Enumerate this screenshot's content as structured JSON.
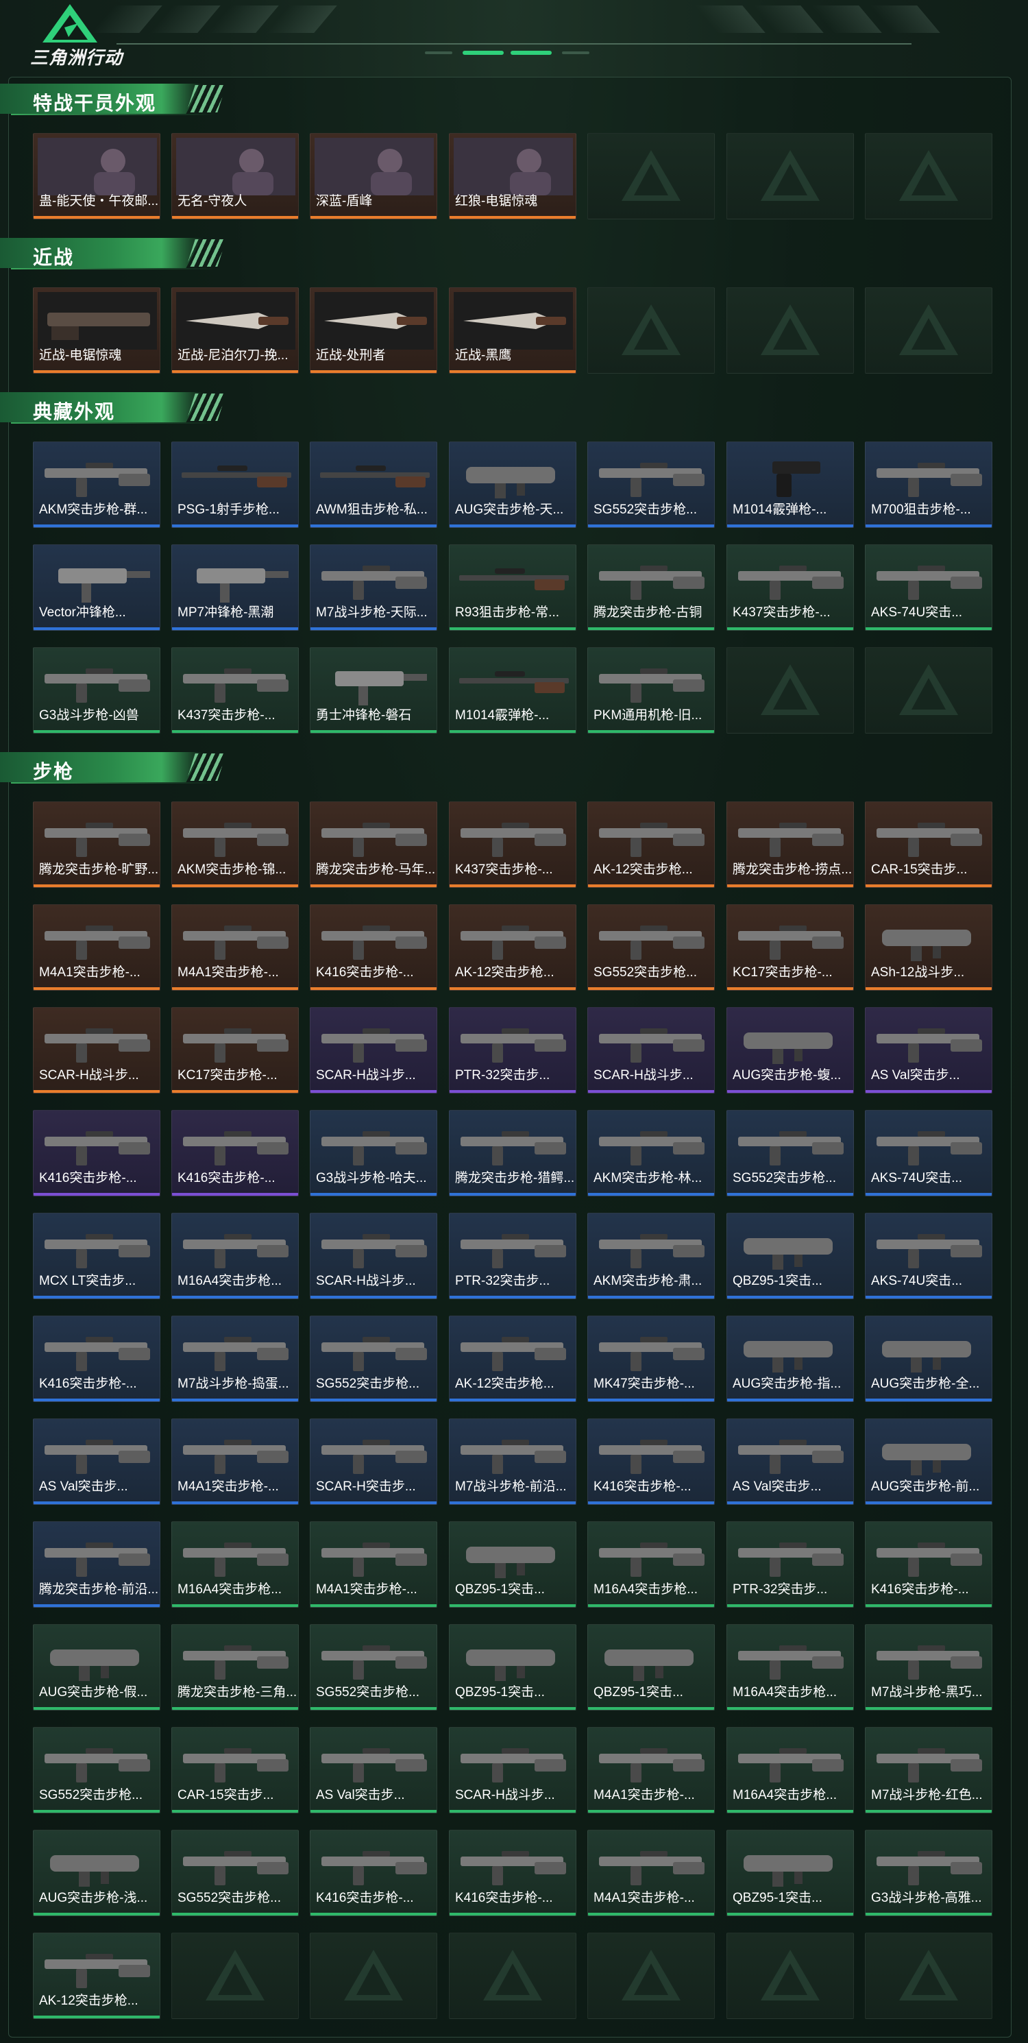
{
  "app": {
    "brand": "三角洲行动"
  },
  "colors": {
    "orange": "#e97d2c",
    "purple": "#7b4fd4",
    "blue": "#2f72d8",
    "green": "#2fb86a",
    "accent": "#3aa85c"
  },
  "sections": [
    {
      "title": "特战干员外观",
      "rows": 1,
      "items": [
        {
          "name": "蛊-能天使・午夜邮...",
          "rarity": "orange",
          "icon": "operator-portrait"
        },
        {
          "name": "无名-守夜人",
          "rarity": "orange",
          "icon": "operator-portrait"
        },
        {
          "name": "深蓝-盾峰",
          "rarity": "orange",
          "icon": "operator-portrait"
        },
        {
          "name": "红狼-电锯惊魂",
          "rarity": "orange",
          "icon": "operator-portrait"
        }
      ]
    },
    {
      "title": "近战",
      "rows": 1,
      "items": [
        {
          "name": "近战-电锯惊魂",
          "rarity": "orange",
          "icon": "chainsaw"
        },
        {
          "name": "近战-尼泊尔刀-挽...",
          "rarity": "orange",
          "icon": "knife"
        },
        {
          "name": "近战-处刑者",
          "rarity": "orange",
          "icon": "knife"
        },
        {
          "name": "近战-黑鹰",
          "rarity": "orange",
          "icon": "knife"
        }
      ]
    },
    {
      "title": "典藏外观",
      "rows": 3,
      "items": [
        {
          "name": "AKM突击步枪-群...",
          "rarity": "blue",
          "icon": "rifle"
        },
        {
          "name": "PSG-1射手步枪...",
          "rarity": "blue",
          "icon": "sniper"
        },
        {
          "name": "AWM狙击步枪-私...",
          "rarity": "blue",
          "icon": "sniper"
        },
        {
          "name": "AUG突击步枪-天...",
          "rarity": "blue",
          "icon": "bullpup"
        },
        {
          "name": "SG552突击步枪...",
          "rarity": "blue",
          "icon": "rifle"
        },
        {
          "name": "M1014霰弹枪-...",
          "rarity": "blue",
          "icon": "pistol"
        },
        {
          "name": "M700狙击步枪-...",
          "rarity": "blue",
          "icon": "rifle"
        },
        {
          "name": "Vector冲锋枪...",
          "rarity": "blue",
          "icon": "smg"
        },
        {
          "name": "MP7冲锋枪-黑潮",
          "rarity": "blue",
          "icon": "smg"
        },
        {
          "name": "M7战斗步枪-天际...",
          "rarity": "blue",
          "icon": "rifle"
        },
        {
          "name": "R93狙击步枪-常...",
          "rarity": "green",
          "icon": "sniper"
        },
        {
          "name": "腾龙突击步枪-古铜",
          "rarity": "green",
          "icon": "rifle"
        },
        {
          "name": "K437突击步枪-...",
          "rarity": "green",
          "icon": "rifle"
        },
        {
          "name": "AKS-74U突击...",
          "rarity": "green",
          "icon": "rifle"
        },
        {
          "name": "G3战斗步枪-凶兽",
          "rarity": "green",
          "icon": "rifle"
        },
        {
          "name": "K437突击步枪-...",
          "rarity": "green",
          "icon": "rifle"
        },
        {
          "name": "勇士冲锋枪-磐石",
          "rarity": "green",
          "icon": "smg"
        },
        {
          "name": "M1014霰弹枪-...",
          "rarity": "green",
          "icon": "sniper"
        },
        {
          "name": "PKM通用机枪-旧...",
          "rarity": "green",
          "icon": "rifle"
        }
      ]
    },
    {
      "title": "步枪",
      "rows": 12,
      "items": [
        {
          "name": "腾龙突击步枪-旷野...",
          "rarity": "orange",
          "icon": "rifle"
        },
        {
          "name": "AKM突击步枪-锦...",
          "rarity": "orange",
          "icon": "rifle"
        },
        {
          "name": "腾龙突击步枪-马年...",
          "rarity": "orange",
          "icon": "rifle"
        },
        {
          "name": "K437突击步枪-...",
          "rarity": "orange",
          "icon": "rifle"
        },
        {
          "name": "AK-12突击步枪...",
          "rarity": "orange",
          "icon": "rifle"
        },
        {
          "name": "腾龙突击步枪-捞点...",
          "rarity": "orange",
          "icon": "rifle"
        },
        {
          "name": "CAR-15突击步...",
          "rarity": "orange",
          "icon": "rifle"
        },
        {
          "name": "M4A1突击步枪-...",
          "rarity": "orange",
          "icon": "rifle"
        },
        {
          "name": "M4A1突击步枪-...",
          "rarity": "orange",
          "icon": "rifle"
        },
        {
          "name": "K416突击步枪-...",
          "rarity": "orange",
          "icon": "rifle"
        },
        {
          "name": "AK-12突击步枪...",
          "rarity": "orange",
          "icon": "rifle"
        },
        {
          "name": "SG552突击步枪...",
          "rarity": "orange",
          "icon": "rifle"
        },
        {
          "name": "KC17突击步枪-...",
          "rarity": "orange",
          "icon": "rifle"
        },
        {
          "name": "ASh-12战斗步...",
          "rarity": "orange",
          "icon": "bullpup"
        },
        {
          "name": "SCAR-H战斗步...",
          "rarity": "orange",
          "icon": "rifle"
        },
        {
          "name": "KC17突击步枪-...",
          "rarity": "orange",
          "icon": "rifle"
        },
        {
          "name": "SCAR-H战斗步...",
          "rarity": "purple",
          "icon": "rifle"
        },
        {
          "name": "PTR-32突击步...",
          "rarity": "purple",
          "icon": "rifle"
        },
        {
          "name": "SCAR-H战斗步...",
          "rarity": "purple",
          "icon": "rifle"
        },
        {
          "name": "AUG突击步枪-蝮...",
          "rarity": "purple",
          "icon": "bullpup"
        },
        {
          "name": "AS Val突击步...",
          "rarity": "purple",
          "icon": "rifle"
        },
        {
          "name": "K416突击步枪-...",
          "rarity": "purple",
          "icon": "rifle"
        },
        {
          "name": "K416突击步枪-...",
          "rarity": "purple",
          "icon": "rifle"
        },
        {
          "name": "G3战斗步枪-哈夫...",
          "rarity": "blue",
          "icon": "rifle"
        },
        {
          "name": "腾龙突击步枪-猎鳄...",
          "rarity": "blue",
          "icon": "rifle"
        },
        {
          "name": "AKM突击步枪-林...",
          "rarity": "blue",
          "icon": "rifle"
        },
        {
          "name": "SG552突击步枪...",
          "rarity": "blue",
          "icon": "rifle"
        },
        {
          "name": "AKS-74U突击...",
          "rarity": "blue",
          "icon": "rifle"
        },
        {
          "name": "MCX LT突击步...",
          "rarity": "blue",
          "icon": "rifle"
        },
        {
          "name": "M16A4突击步枪...",
          "rarity": "blue",
          "icon": "rifle"
        },
        {
          "name": "SCAR-H战斗步...",
          "rarity": "blue",
          "icon": "rifle"
        },
        {
          "name": "PTR-32突击步...",
          "rarity": "blue",
          "icon": "rifle"
        },
        {
          "name": "AKM突击步枪-肃...",
          "rarity": "blue",
          "icon": "rifle"
        },
        {
          "name": "QBZ95-1突击...",
          "rarity": "blue",
          "icon": "bullpup"
        },
        {
          "name": "AKS-74U突击...",
          "rarity": "blue",
          "icon": "rifle"
        },
        {
          "name": "K416突击步枪-...",
          "rarity": "blue",
          "icon": "rifle"
        },
        {
          "name": "M7战斗步枪-捣蛋...",
          "rarity": "blue",
          "icon": "rifle"
        },
        {
          "name": "SG552突击步枪...",
          "rarity": "blue",
          "icon": "rifle"
        },
        {
          "name": "AK-12突击步枪...",
          "rarity": "blue",
          "icon": "rifle"
        },
        {
          "name": "MK47突击步枪-...",
          "rarity": "blue",
          "icon": "rifle"
        },
        {
          "name": "AUG突击步枪-指...",
          "rarity": "blue",
          "icon": "bullpup"
        },
        {
          "name": "AUG突击步枪-全...",
          "rarity": "blue",
          "icon": "bullpup"
        },
        {
          "name": "AS Val突击步...",
          "rarity": "blue",
          "icon": "rifle"
        },
        {
          "name": "M4A1突击步枪-...",
          "rarity": "blue",
          "icon": "rifle"
        },
        {
          "name": "SCAR-H突击步...",
          "rarity": "blue",
          "icon": "rifle"
        },
        {
          "name": "M7战斗步枪-前沿...",
          "rarity": "blue",
          "icon": "rifle"
        },
        {
          "name": "K416突击步枪-...",
          "rarity": "blue",
          "icon": "rifle"
        },
        {
          "name": "AS Val突击步...",
          "rarity": "blue",
          "icon": "rifle"
        },
        {
          "name": "AUG突击步枪-前...",
          "rarity": "blue",
          "icon": "bullpup"
        },
        {
          "name": "腾龙突击步枪-前沿...",
          "rarity": "blue",
          "icon": "rifle"
        },
        {
          "name": "M16A4突击步枪...",
          "rarity": "green",
          "icon": "rifle"
        },
        {
          "name": "M4A1突击步枪-...",
          "rarity": "green",
          "icon": "rifle"
        },
        {
          "name": "QBZ95-1突击...",
          "rarity": "green",
          "icon": "bullpup"
        },
        {
          "name": "M16A4突击步枪...",
          "rarity": "green",
          "icon": "rifle"
        },
        {
          "name": "PTR-32突击步...",
          "rarity": "green",
          "icon": "rifle"
        },
        {
          "name": "K416突击步枪-...",
          "rarity": "green",
          "icon": "rifle"
        },
        {
          "name": "AUG突击步枪-假...",
          "rarity": "green",
          "icon": "bullpup"
        },
        {
          "name": "腾龙突击步枪-三角...",
          "rarity": "green",
          "icon": "rifle"
        },
        {
          "name": "SG552突击步枪...",
          "rarity": "green",
          "icon": "rifle"
        },
        {
          "name": "QBZ95-1突击...",
          "rarity": "green",
          "icon": "bullpup"
        },
        {
          "name": "QBZ95-1突击...",
          "rarity": "green",
          "icon": "bullpup"
        },
        {
          "name": "M16A4突击步枪...",
          "rarity": "green",
          "icon": "rifle"
        },
        {
          "name": "M7战斗步枪-黑巧...",
          "rarity": "green",
          "icon": "rifle"
        },
        {
          "name": "SG552突击步枪...",
          "rarity": "green",
          "icon": "rifle"
        },
        {
          "name": "CAR-15突击步...",
          "rarity": "green",
          "icon": "rifle"
        },
        {
          "name": "AS Val突击步...",
          "rarity": "green",
          "icon": "rifle"
        },
        {
          "name": "SCAR-H战斗步...",
          "rarity": "green",
          "icon": "rifle"
        },
        {
          "name": "M4A1突击步枪-...",
          "rarity": "green",
          "icon": "rifle"
        },
        {
          "name": "M16A4突击步枪...",
          "rarity": "green",
          "icon": "rifle"
        },
        {
          "name": "M7战斗步枪-红色...",
          "rarity": "green",
          "icon": "rifle"
        },
        {
          "name": "AUG突击步枪-浅...",
          "rarity": "green",
          "icon": "bullpup"
        },
        {
          "name": "SG552突击步枪...",
          "rarity": "green",
          "icon": "rifle"
        },
        {
          "name": "K416突击步枪-...",
          "rarity": "green",
          "icon": "rifle"
        },
        {
          "name": "K416突击步枪-...",
          "rarity": "green",
          "icon": "rifle"
        },
        {
          "name": "M4A1突击步枪-...",
          "rarity": "green",
          "icon": "rifle"
        },
        {
          "name": "QBZ95-1突击...",
          "rarity": "green",
          "icon": "bullpup"
        },
        {
          "name": "G3战斗步枪-高雅...",
          "rarity": "green",
          "icon": "rifle"
        },
        {
          "name": "AK-12突击步枪...",
          "rarity": "green",
          "icon": "rifle"
        }
      ]
    }
  ]
}
